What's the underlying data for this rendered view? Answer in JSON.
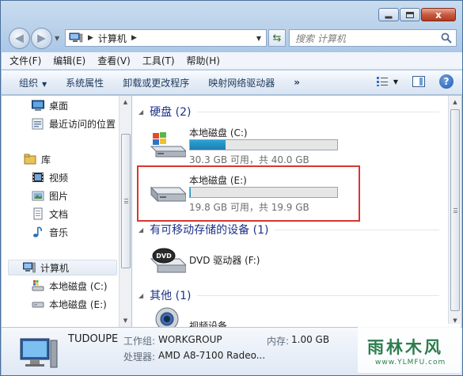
{
  "window": {
    "caption_close": "x"
  },
  "nav": {
    "address_segment": "计算机",
    "search_placeholder": "搜索 计算机"
  },
  "menu": [
    "文件(F)",
    "编辑(E)",
    "查看(V)",
    "工具(T)",
    "帮助(H)"
  ],
  "commands": {
    "organize": "组织",
    "system_properties": "系统属性",
    "uninstall": "卸载或更改程序",
    "map_drive": "映射网络驱动器",
    "more": "»",
    "help": "?"
  },
  "sidebar": {
    "items": [
      {
        "label": "桌面",
        "icon": "desktop-icon"
      },
      {
        "label": "最近访问的位置",
        "icon": "recent-places-icon"
      },
      {
        "label": "库",
        "icon": "library-icon"
      },
      {
        "label": "视频",
        "icon": "video-library-icon"
      },
      {
        "label": "图片",
        "icon": "pictures-library-icon"
      },
      {
        "label": "文档",
        "icon": "documents-library-icon"
      },
      {
        "label": "音乐",
        "icon": "music-library-icon"
      },
      {
        "label": "计算机",
        "icon": "computer-icon"
      },
      {
        "label": "本地磁盘 (C:)",
        "icon": "drive-c-icon"
      },
      {
        "label": "本地磁盘 (E:)",
        "icon": "drive-e-icon"
      }
    ]
  },
  "content": {
    "groups": {
      "hdd": "硬盘 (2)",
      "removable": "有可移动存储的设备 (1)",
      "other": "其他 (1)"
    },
    "drives": [
      {
        "name": "本地磁盘 (C:)",
        "free_text": "30.3 GB 可用，共 40.0 GB",
        "used_fraction": 0.24
      },
      {
        "name": "本地磁盘 (E:)",
        "free_text": "19.8 GB 可用，共 19.9 GB",
        "used_fraction": 0.005
      }
    ],
    "dvd": {
      "name": "DVD 驱动器 (F:)"
    },
    "other_device": {
      "name": "视频设备"
    }
  },
  "details": {
    "computer_name": "TUDOUPE",
    "workgroup_label": "工作组:",
    "workgroup": "WORKGROUP",
    "memory_label": "内存:",
    "memory": "1.00 GB",
    "cpu_label": "处理器:",
    "cpu": "AMD A8-7100 Radeo..."
  },
  "watermark": {
    "main": "雨林木风",
    "sub": "www.YLMFU.com"
  },
  "colors": {
    "highlight_box": "#d7372f",
    "drive_fill": "#1b7fb4",
    "group_header": "#1e3287"
  }
}
